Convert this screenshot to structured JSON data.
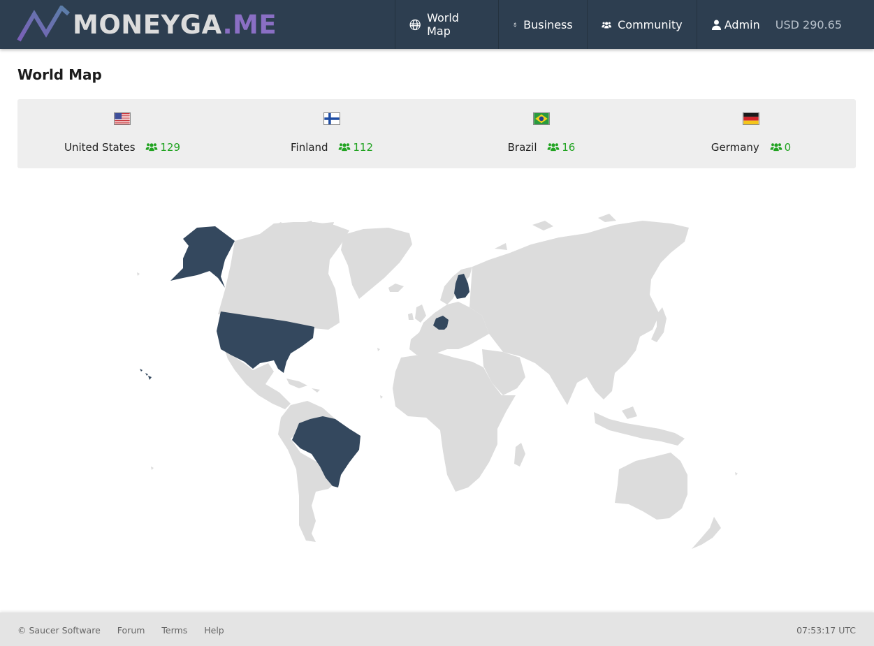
{
  "brand": {
    "name_main": "MONEYGA",
    "name_accent": ".ME"
  },
  "nav": {
    "world_map": "World Map",
    "business": "Business",
    "community": "Community",
    "admin": "Admin",
    "balance": "USD 290.65"
  },
  "page": {
    "title": "World Map"
  },
  "stats": [
    {
      "country": "United States",
      "count": "129",
      "flag": "us-flag"
    },
    {
      "country": "Finland",
      "count": "112",
      "flag": "fi-flag"
    },
    {
      "country": "Brazil",
      "count": "16",
      "flag": "br-flag"
    },
    {
      "country": "Germany",
      "count": "0",
      "flag": "de-flag"
    }
  ],
  "map": {
    "highlighted": [
      "United States",
      "Finland",
      "Brazil",
      "Germany"
    ],
    "colors": {
      "land": "#dcdcdc",
      "highlight": "#34485e"
    }
  },
  "colors": {
    "header": "#2d3e50",
    "count_green": "#21a321",
    "accent": "#8a6fc4"
  },
  "footer": {
    "copyright": "© Saucer Software",
    "links": [
      "Forum",
      "Terms",
      "Help"
    ],
    "time": "07:53:17 UTC"
  }
}
